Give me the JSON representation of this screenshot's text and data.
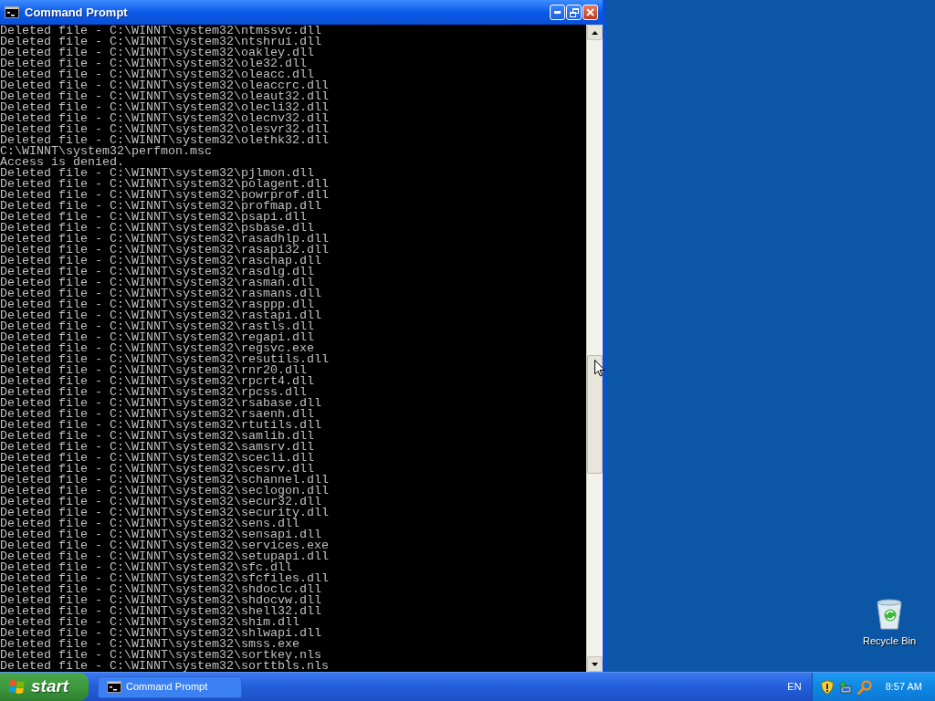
{
  "window": {
    "title": "Command Prompt"
  },
  "console": {
    "lines": [
      "Deleted file - C:\\WINNT\\system32\\ntmssvc.dll",
      "Deleted file - C:\\WINNT\\system32\\ntshrui.dll",
      "Deleted file - C:\\WINNT\\system32\\oakley.dll",
      "Deleted file - C:\\WINNT\\system32\\ole32.dll",
      "Deleted file - C:\\WINNT\\system32\\oleacc.dll",
      "Deleted file - C:\\WINNT\\system32\\oleaccrc.dll",
      "Deleted file - C:\\WINNT\\system32\\oleaut32.dll",
      "Deleted file - C:\\WINNT\\system32\\olecli32.dll",
      "Deleted file - C:\\WINNT\\system32\\olecnv32.dll",
      "Deleted file - C:\\WINNT\\system32\\olesvr32.dll",
      "Deleted file - C:\\WINNT\\system32\\olethk32.dll",
      "C:\\WINNT\\system32\\perfmon.msc",
      "Access is denied.",
      "Deleted file - C:\\WINNT\\system32\\pjlmon.dll",
      "Deleted file - C:\\WINNT\\system32\\polagent.dll",
      "Deleted file - C:\\WINNT\\system32\\powrprof.dll",
      "Deleted file - C:\\WINNT\\system32\\profmap.dll",
      "Deleted file - C:\\WINNT\\system32\\psapi.dll",
      "Deleted file - C:\\WINNT\\system32\\psbase.dll",
      "Deleted file - C:\\WINNT\\system32\\rasadhlp.dll",
      "Deleted file - C:\\WINNT\\system32\\rasapi32.dll",
      "Deleted file - C:\\WINNT\\system32\\raschap.dll",
      "Deleted file - C:\\WINNT\\system32\\rasdlg.dll",
      "Deleted file - C:\\WINNT\\system32\\rasman.dll",
      "Deleted file - C:\\WINNT\\system32\\rasmans.dll",
      "Deleted file - C:\\WINNT\\system32\\rasppp.dll",
      "Deleted file - C:\\WINNT\\system32\\rastapi.dll",
      "Deleted file - C:\\WINNT\\system32\\rastls.dll",
      "Deleted file - C:\\WINNT\\system32\\regapi.dll",
      "Deleted file - C:\\WINNT\\system32\\regsvc.exe",
      "Deleted file - C:\\WINNT\\system32\\resutils.dll",
      "Deleted file - C:\\WINNT\\system32\\rnr20.dll",
      "Deleted file - C:\\WINNT\\system32\\rpcrt4.dll",
      "Deleted file - C:\\WINNT\\system32\\rpcss.dll",
      "Deleted file - C:\\WINNT\\system32\\rsabase.dll",
      "Deleted file - C:\\WINNT\\system32\\rsaenh.dll",
      "Deleted file - C:\\WINNT\\system32\\rtutils.dll",
      "Deleted file - C:\\WINNT\\system32\\samlib.dll",
      "Deleted file - C:\\WINNT\\system32\\samsrv.dll",
      "Deleted file - C:\\WINNT\\system32\\scecli.dll",
      "Deleted file - C:\\WINNT\\system32\\scesrv.dll",
      "Deleted file - C:\\WINNT\\system32\\schannel.dll",
      "Deleted file - C:\\WINNT\\system32\\seclogon.dll",
      "Deleted file - C:\\WINNT\\system32\\secur32.dll",
      "Deleted file - C:\\WINNT\\system32\\security.dll",
      "Deleted file - C:\\WINNT\\system32\\sens.dll",
      "Deleted file - C:\\WINNT\\system32\\sensapi.dll",
      "Deleted file - C:\\WINNT\\system32\\services.exe",
      "Deleted file - C:\\WINNT\\system32\\setupapi.dll",
      "Deleted file - C:\\WINNT\\system32\\sfc.dll",
      "Deleted file - C:\\WINNT\\system32\\sfcfiles.dll",
      "Deleted file - C:\\WINNT\\system32\\shdoclc.dll",
      "Deleted file - C:\\WINNT\\system32\\shdocvw.dll",
      "Deleted file - C:\\WINNT\\system32\\shell32.dll",
      "Deleted file - C:\\WINNT\\system32\\shim.dll",
      "Deleted file - C:\\WINNT\\system32\\shlwapi.dll",
      "Deleted file - C:\\WINNT\\system32\\smss.exe",
      "Deleted file - C:\\WINNT\\system32\\sortkey.nls",
      "Deleted file - C:\\WINNT\\system32\\sorttbls.nls"
    ]
  },
  "desktop": {
    "icons": [
      {
        "label": "Recycle Bin"
      }
    ]
  },
  "taskbar": {
    "start": "start",
    "tasks": [
      {
        "label": "Command Prompt",
        "selected": false
      }
    ],
    "language": "EN",
    "clock": "8:57 AM"
  }
}
